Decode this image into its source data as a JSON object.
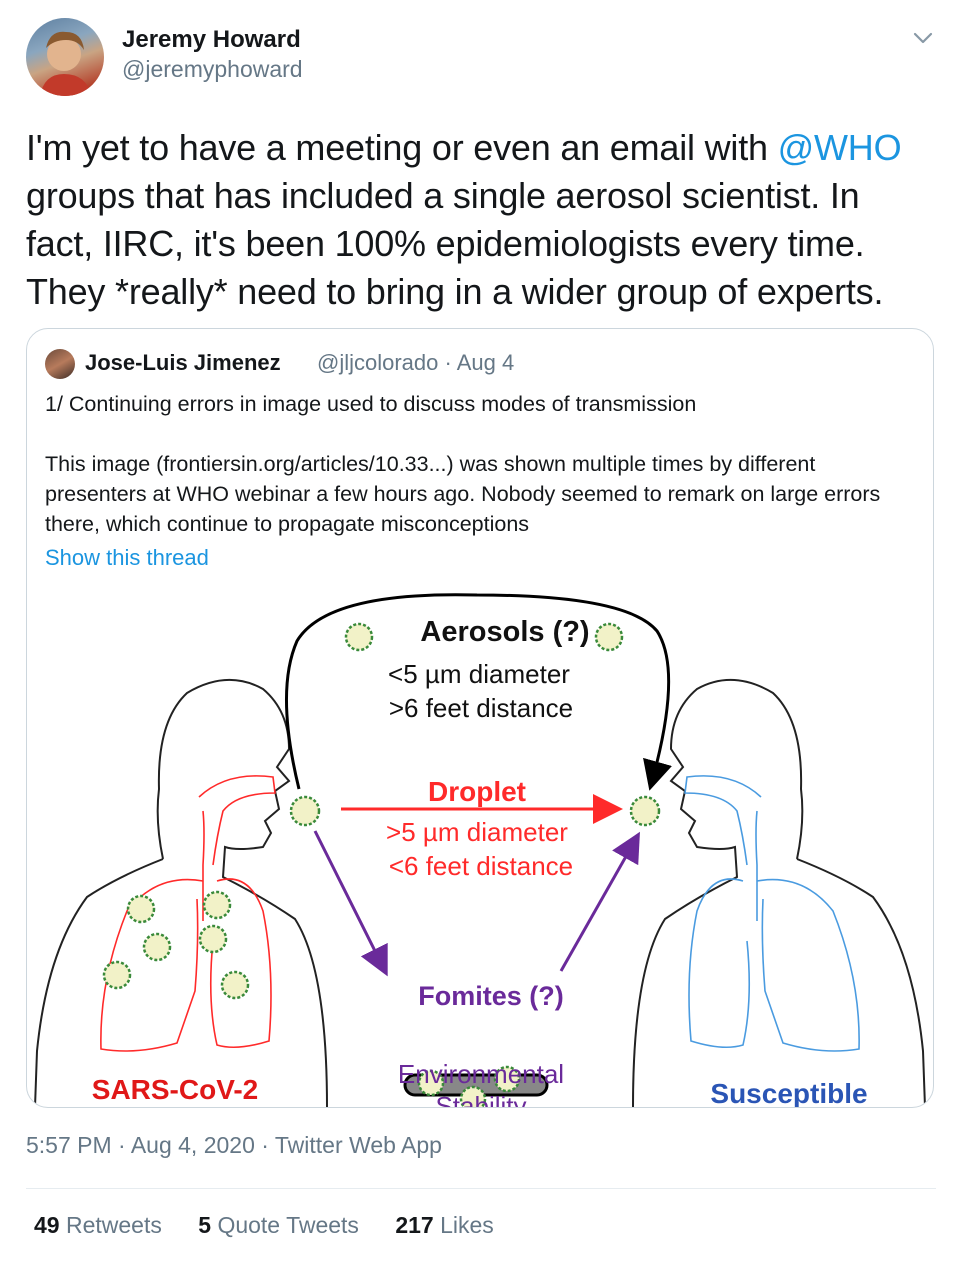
{
  "author": {
    "name": "Jeremy Howard",
    "handle": "@jeremyphoward"
  },
  "tweet": {
    "text_before": "I'm yet to have a meeting or even an email with ",
    "mention": "@WHO",
    "text_after": " groups that has included a single aerosol scientist. In fact, IIRC, it's been 100% epidemiologists every time. They *really* need to bring in a wider group of experts."
  },
  "quoted": {
    "name": "Jose-Luis Jimenez",
    "handle_date": "@jljcolorado · Aug 4",
    "line1": "1/ Continuing errors in image used to discuss modes of transmission",
    "line2": "This image (frontiersin.org/articles/10.33...) was shown multiple times by different presenters at WHO webinar a few hours ago. Nobody seemed to remark on large errors there, which continue to propagate misconceptions",
    "show_thread": "Show this thread",
    "figure": {
      "aerosols_title": "Aerosols (?)",
      "aerosols_line1": "<5 µm diameter",
      "aerosols_line2": ">6 feet distance",
      "droplet_title": "Droplet",
      "droplet_line1": ">5 µm diameter",
      "droplet_line2": "<6 feet distance",
      "fomites_title": "Fomites (?)",
      "environmental": "Environmental",
      "stability": "Stability",
      "left_label": "SARS-CoV-2",
      "right_label": "Susceptible",
      "colors": {
        "red": "#ff2a2a",
        "blue": "#4a9be0",
        "purple": "#6a2a9a",
        "label_blue": "#2a55b5",
        "virus_yellow": "#d8b83a",
        "virus_green": "#3a8a3a"
      }
    }
  },
  "meta": {
    "time": "5:57 PM · Aug 4, 2020 · Twitter Web App"
  },
  "stats": {
    "retweets_count": "49",
    "retweets_label": "Retweets",
    "quotes_count": "5",
    "quotes_label": "Quote Tweets",
    "likes_count": "217",
    "likes_label": "Likes"
  }
}
